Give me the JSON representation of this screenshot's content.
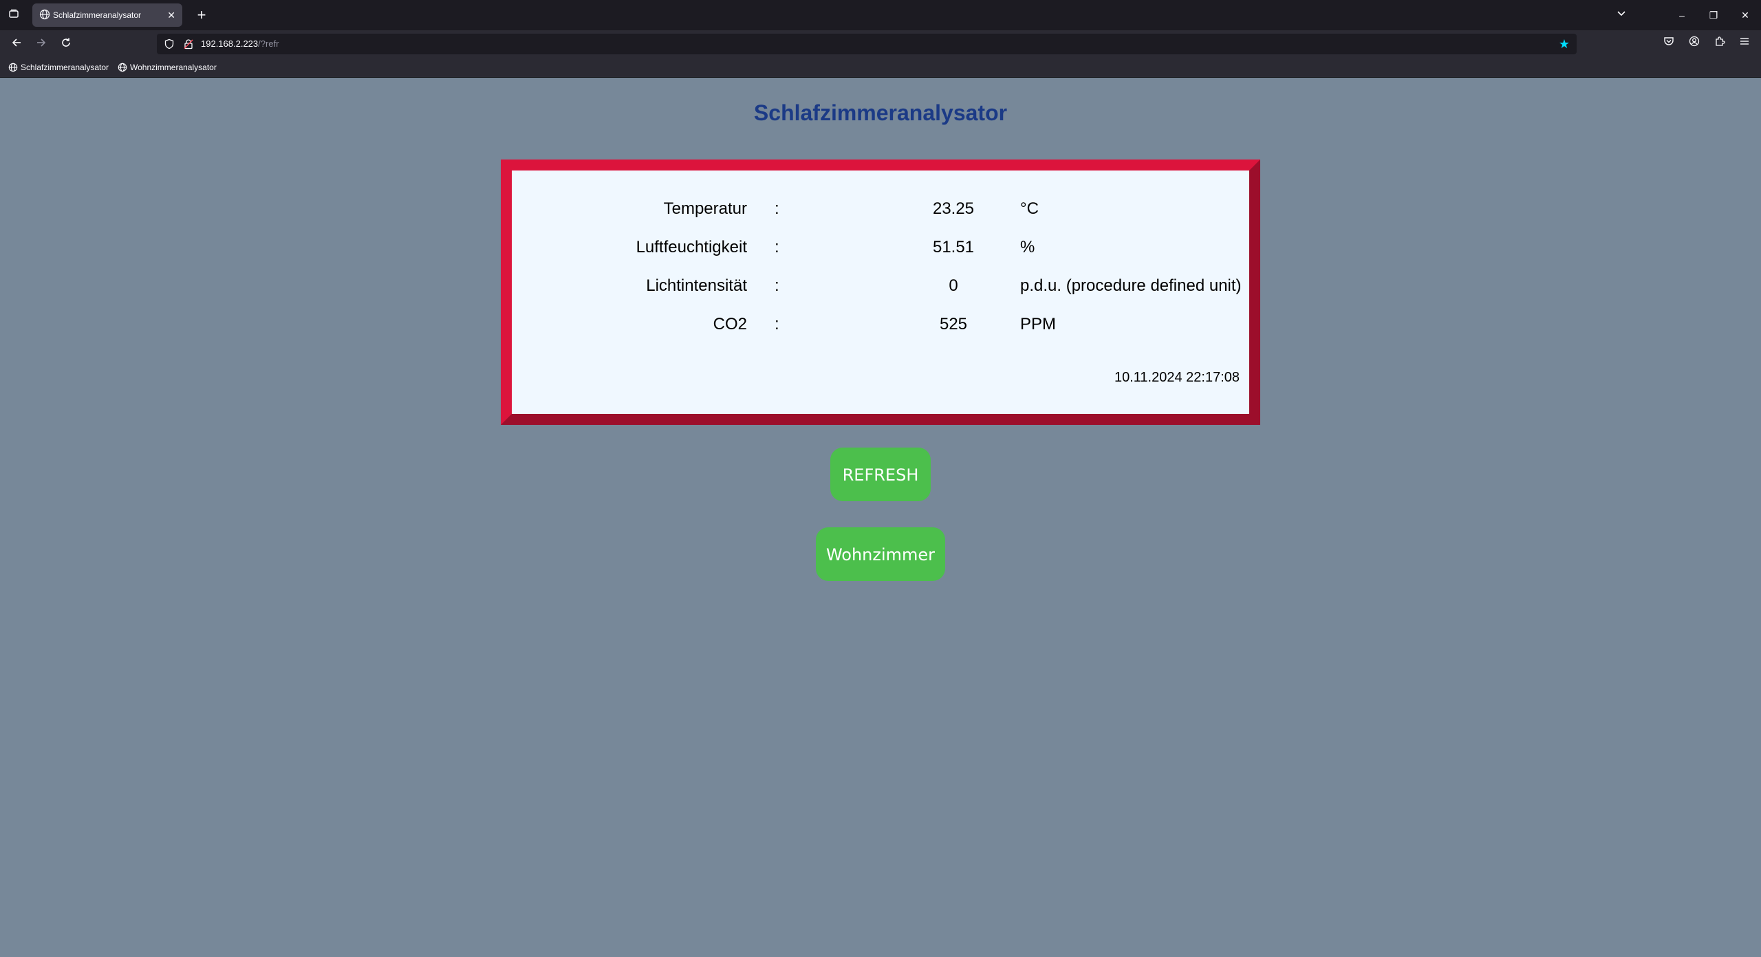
{
  "browser": {
    "tab": {
      "title": "Schlafzimmeranalysator"
    },
    "url": {
      "host": "192.168.2.223",
      "path": "/?refr"
    },
    "bookmarks": [
      {
        "label": "Schlafzimmeranalysator"
      },
      {
        "label": "Wohnzimmeranalysator"
      }
    ]
  },
  "page": {
    "title": "Schlafzimmeranalysator",
    "readings": [
      {
        "label": "Temperatur",
        "separator": ":",
        "value": "23.25",
        "unit": "°C"
      },
      {
        "label": "Luftfeuchtigkeit",
        "separator": ":",
        "value": "51.51",
        "unit": "%"
      },
      {
        "label": "Lichtintensität",
        "separator": ":",
        "value": "0",
        "unit": "p.d.u. (procedure defined unit)"
      },
      {
        "label": "CO2",
        "separator": ":",
        "value": "525",
        "unit": "PPM"
      }
    ],
    "timestamp": "10.11.2024 22:17:08",
    "buttons": {
      "refresh": "REFRESH",
      "wohnzimmer": "Wohnzimmer"
    }
  },
  "colors": {
    "background": "#778899",
    "title": "#1b3a86",
    "card_border": "#dc143c",
    "card_background": "#f0f8ff",
    "button": "#4cbf4c"
  }
}
